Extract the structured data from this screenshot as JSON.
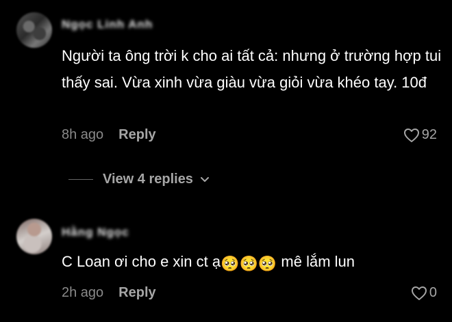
{
  "comments": [
    {
      "username": "Ngọc Linh Anh",
      "text": "Người ta ông trời k cho ai tất cả: nhưng ở trường hợp tui thấy sai. Vừa xinh vừa giàu vừa giỏi vừa khéo tay. 10đ",
      "time": "8h ago",
      "reply_label": "Reply",
      "likes": "92",
      "view_replies": "View 4 replies"
    },
    {
      "username": "Hằng Ngọc",
      "text_before_emoji": "C Loan ơi cho e xin ct ạ",
      "emoji": "🥺🥺🥺",
      "text_after_emoji": " mê lắm lun",
      "time": "2h ago",
      "reply_label": "Reply",
      "likes": "0"
    }
  ],
  "colors": {
    "background": "#000000",
    "text": "#ffffff",
    "muted": "#8a8a8a",
    "action": "#a6a6a6"
  }
}
